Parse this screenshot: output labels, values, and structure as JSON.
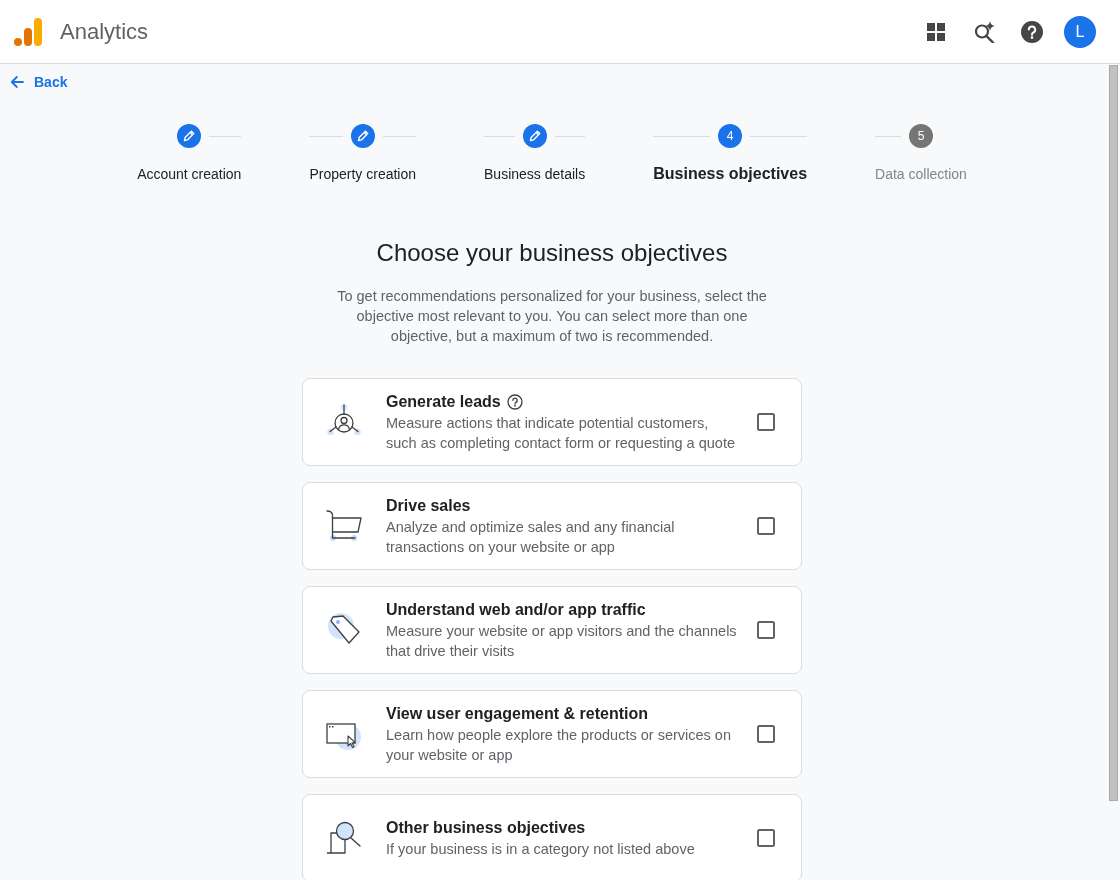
{
  "header": {
    "app_name": "Analytics",
    "avatar_initial": "L"
  },
  "back_link": {
    "label": "Back"
  },
  "steps": [
    {
      "label": "Account creation",
      "completed": true,
      "selected": false
    },
    {
      "label": "Property creation",
      "completed": true,
      "selected": false
    },
    {
      "label": "Business details",
      "completed": true,
      "selected": false
    },
    {
      "label": "Business objectives",
      "number": "4",
      "completed": false,
      "selected": true
    },
    {
      "label": "Data collection",
      "number": "5",
      "completed": false,
      "selected": false
    }
  ],
  "page": {
    "title": "Choose your business objectives",
    "description": "To get recommendations personalized for your business, select the objective most relevant to you. You can select more than one objective, but a maximum of two is recommended."
  },
  "objectives": [
    {
      "title": "Generate leads",
      "help": true,
      "description": "Measure actions that indicate potential customers, such as completing contact form or requesting a quote",
      "checked": false
    },
    {
      "title": "Drive sales",
      "help": false,
      "description": "Analyze and optimize sales and any financial transactions on your website or app",
      "checked": false
    },
    {
      "title": "Understand web and/or app traffic",
      "help": false,
      "description": "Measure your website or app visitors and the channels that drive their visits",
      "checked": false
    },
    {
      "title": "View user engagement & retention",
      "help": false,
      "description": "Learn how people explore the products or services on your website or app",
      "checked": false
    },
    {
      "title": "Other business objectives",
      "help": false,
      "description": "If your business is in a category not listed above",
      "checked": false
    }
  ]
}
